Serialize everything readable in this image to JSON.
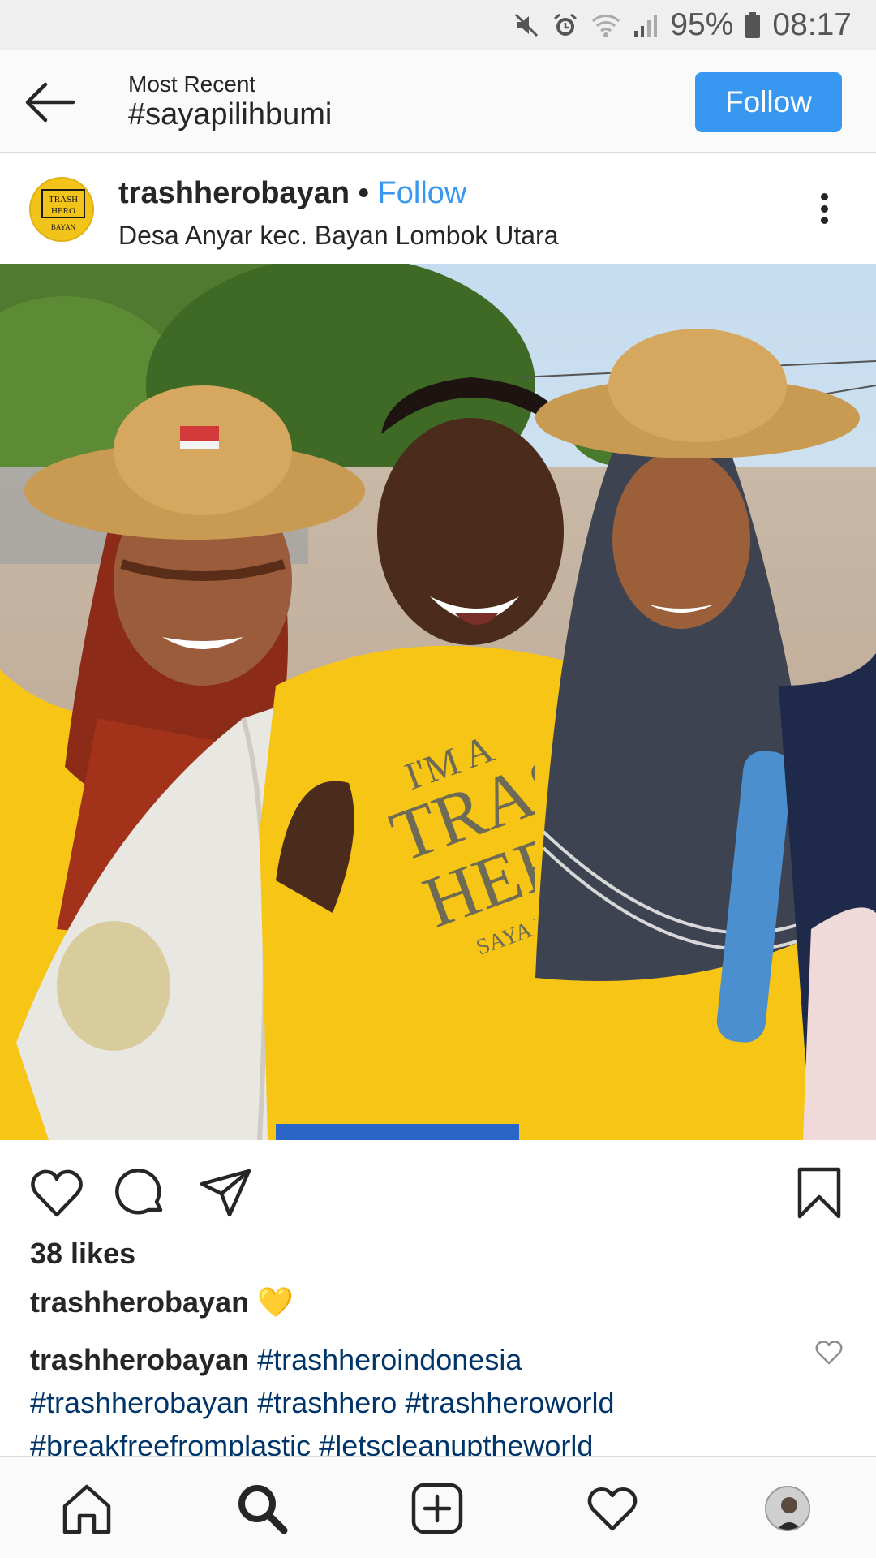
{
  "status_bar": {
    "battery": "95%",
    "time": "08:17",
    "icons": [
      "mute-icon",
      "alarm-icon",
      "wifi-icon",
      "signal-icon",
      "battery-icon"
    ]
  },
  "header": {
    "subtitle": "Most Recent",
    "title": "#sayapilihbumi",
    "follow_label": "Follow"
  },
  "post": {
    "username": "trashherobayan",
    "separator": "•",
    "follow_label": "Follow",
    "location": "Desa Anyar kec. Bayan Lombok Utara",
    "avatar_logo": [
      "TRASH",
      "HERO",
      "BAYAN"
    ],
    "photo_shirt_text": [
      "I'M A",
      "TRAS",
      "HER",
      "SAYA PAHLA"
    ],
    "likes": "38 likes",
    "caption_user": "trashherobayan",
    "caption_emoji": "💛",
    "comment_user": "trashherobayan",
    "hashtags": [
      "#trashheroindonesia",
      "#trashherobayan",
      "#trashhero",
      "#trashheroworld",
      "#breakfreefromplastic",
      "#letscleanuptheworld"
    ]
  },
  "actions": {
    "icons": [
      "heart-icon",
      "comment-icon",
      "share-icon",
      "bookmark-icon"
    ]
  },
  "bottom_nav": {
    "items": [
      "home-icon",
      "search-icon",
      "add-icon",
      "activity-icon",
      "profile-avatar"
    ]
  },
  "colors": {
    "accent": "#3897f0",
    "hashtag": "#003569",
    "shirt_yellow": "#f6c516"
  }
}
